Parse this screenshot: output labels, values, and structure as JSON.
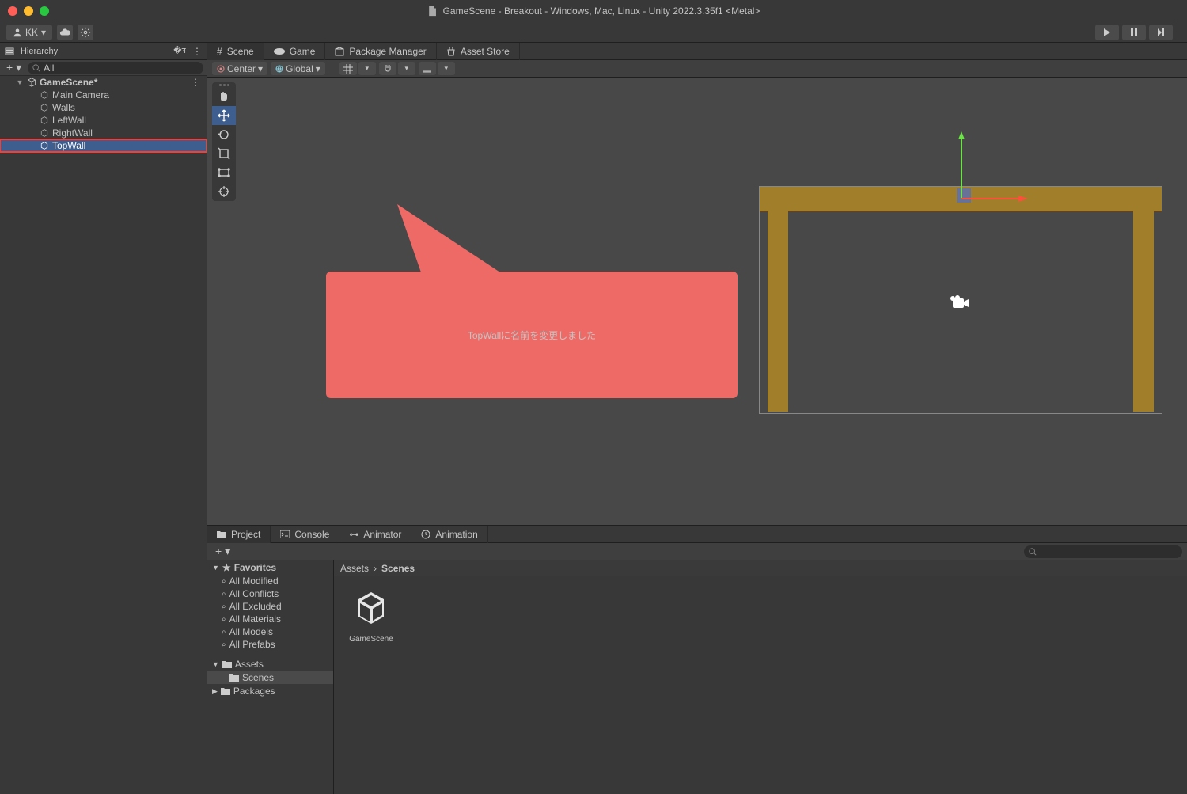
{
  "window": {
    "title": "GameScene - Breakout - Windows, Mac, Linux - Unity 2022.3.35f1 <Metal>"
  },
  "toolbar": {
    "account": "KK"
  },
  "playback": {
    "play": "play",
    "pause": "pause",
    "step": "step"
  },
  "hierarchy": {
    "title": "Hierarchy",
    "search_placeholder": "All",
    "root": "GameScene*",
    "items": [
      {
        "name": "Main Camera",
        "indent": 50
      },
      {
        "name": "Walls",
        "indent": 50
      },
      {
        "name": "LeftWall",
        "indent": 50
      },
      {
        "name": "RightWall",
        "indent": 50
      },
      {
        "name": "TopWall",
        "indent": 50,
        "selected": true,
        "highlighted": true
      }
    ]
  },
  "viewTabs": {
    "scene": "Scene",
    "game": "Game",
    "packageManager": "Package Manager",
    "assetStore": "Asset Store"
  },
  "sceneToolbar": {
    "pivot": "Center",
    "space": "Global"
  },
  "callout": {
    "text": "TopWallに名前を変更しました"
  },
  "bottomTabs": {
    "project": "Project",
    "console": "Console",
    "animator": "Animator",
    "animation": "Animation"
  },
  "project": {
    "favorites": "Favorites",
    "favItems": [
      "All Modified",
      "All Conflicts",
      "All Excluded",
      "All Materials",
      "All Models",
      "All Prefabs"
    ],
    "assets": "Assets",
    "assetsChildren": [
      "Scenes"
    ],
    "packages": "Packages",
    "breadcrumb": [
      "Assets",
      "Scenes"
    ],
    "sceneAsset": "GameScene"
  }
}
